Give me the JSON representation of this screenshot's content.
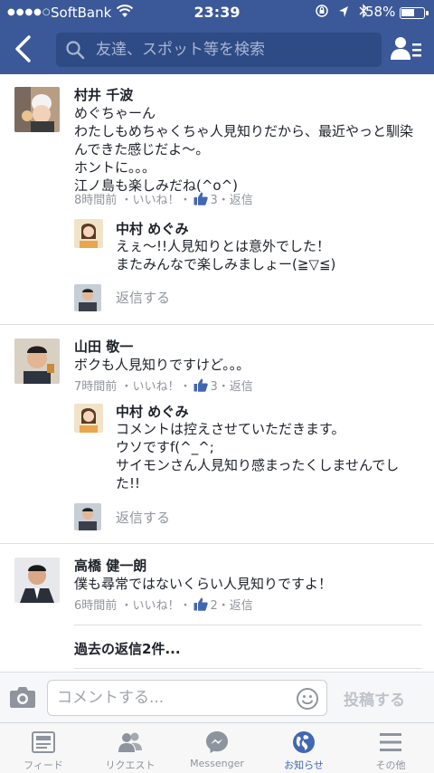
{
  "status_bar": {
    "signal": "●●●●○",
    "carrier": "SoftBank",
    "time": "23:39",
    "battery": "58%"
  },
  "nav": {
    "search_placeholder": "友達、スポット等を検索"
  },
  "comments": [
    {
      "author": "村井 千波",
      "text": "めぐちゃーん\nわたしもめちゃくちゃ人見知りだから、最近やっと馴染んできた感じだよ〜。\nホントに。。。\n江ノ島も楽しみだね(^o^)",
      "time": "8時間前",
      "like_label": "いいね！",
      "like_count": "3",
      "reply_label": "返信",
      "replies": [
        {
          "author": "中村 めぐみ",
          "text": "えぇ〜!!人見知りとは意外でした！\nまたみんなで楽しみましょー(≧▽≦)"
        }
      ],
      "reply_placeholder": "返信する"
    },
    {
      "author": "山田 敬一",
      "text": "ボクも人見知りですけど。。。",
      "time": "7時間前",
      "like_label": "いいね！",
      "like_count": "3",
      "reply_label": "返信",
      "replies": [
        {
          "author": "中村 めぐみ",
          "text": "コメントは控えさせていただきます。\nウソですf(^_^;\nサイモンさん人見知り感まったくしませんでした!!"
        }
      ],
      "reply_placeholder": "返信する"
    },
    {
      "author": "高橋 健一朗",
      "text": "僕も尋常ではないくらい人見知りですよ！",
      "time": "6時間前",
      "like_label": "いいね！",
      "like_count": "2",
      "reply_label": "返信",
      "more_replies": "過去の返信2件..."
    }
  ],
  "composer": {
    "placeholder": "コメントする...",
    "post_label": "投稿する"
  },
  "tabs": [
    {
      "label": "フィード",
      "icon": "feed-icon",
      "active": false
    },
    {
      "label": "リクエスト",
      "icon": "friend-requests-icon",
      "active": false
    },
    {
      "label": "Messenger",
      "icon": "messenger-icon",
      "active": false
    },
    {
      "label": "お知らせ",
      "icon": "globe-icon",
      "active": true
    },
    {
      "label": "その他",
      "icon": "menu-icon",
      "active": false
    }
  ],
  "colors": {
    "brand_blue": "#3b5998",
    "search_bg": "#2f4b85",
    "link_blue": "#4267b2",
    "meta_gray": "#90949c"
  }
}
